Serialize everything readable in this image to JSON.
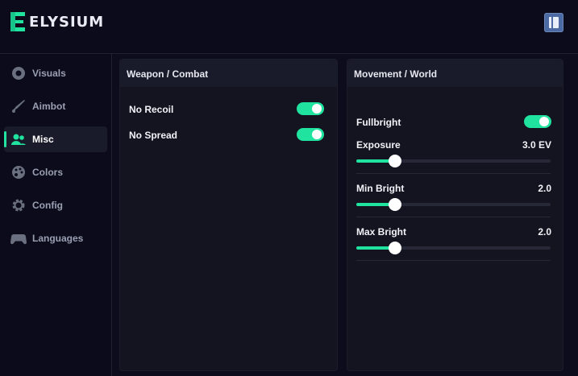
{
  "app": {
    "logo_text": "ELYSIUM"
  },
  "sidebar": {
    "items": [
      {
        "label": "Visuals",
        "icon": "eye-icon"
      },
      {
        "label": "Aimbot",
        "icon": "sword-icon"
      },
      {
        "label": "Misc",
        "icon": "users-icon",
        "active": true
      },
      {
        "label": "Colors",
        "icon": "palette-icon"
      },
      {
        "label": "Config",
        "icon": "gear-icon"
      },
      {
        "label": "Languages",
        "icon": "gamepad-icon"
      }
    ]
  },
  "panels": {
    "weapon": {
      "title": "Weapon / Combat",
      "toggles": [
        {
          "label": "No Recoil",
          "on": true
        },
        {
          "label": "No Spread",
          "on": true
        }
      ]
    },
    "movement": {
      "title": "Movement / World",
      "fullbright": {
        "label": "Fullbright",
        "on": true
      },
      "sliders": [
        {
          "label": "Exposure",
          "value_text": "3.0 EV",
          "fraction": 0.2
        },
        {
          "label": "Min Bright",
          "value_text": "2.0",
          "fraction": 0.2
        },
        {
          "label": "Max Bright",
          "value_text": "2.0",
          "fraction": 0.2
        }
      ]
    }
  },
  "colors": {
    "accent": "#1fe39e",
    "background": "#0c0c1c",
    "panel": "#13141f"
  }
}
